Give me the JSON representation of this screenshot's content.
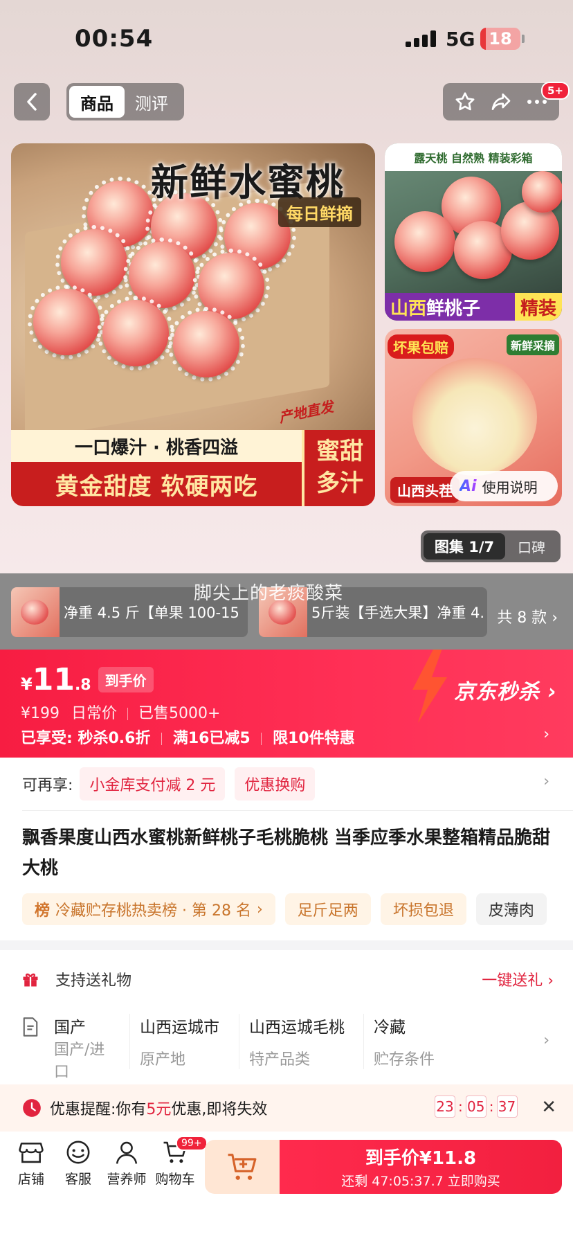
{
  "status_bar": {
    "time": "00:54",
    "network": "5G",
    "battery": "18"
  },
  "nav": {
    "tabs": [
      {
        "label": "商品",
        "active": true
      },
      {
        "label": "测评",
        "active": false
      }
    ],
    "message_badge": "5+",
    "icons": [
      "back-icon",
      "star-icon",
      "share-icon",
      "more-icon"
    ]
  },
  "gallery": {
    "main": {
      "title": "新鲜水蜜桃",
      "daily_tag": "每日鲜摘",
      "origin_tag": "产地直发",
      "banner_top": "一口爆汁 · 桃香四溢",
      "banner_bottom": "黄金甜度 软硬两吃",
      "banner_right": [
        "蜜甜",
        "多汁"
      ]
    },
    "right_top": {
      "top_text": "露天桃 自然熟 精装彩箱",
      "bottom_accent": "山西",
      "bottom_text": "鲜桃子",
      "pack_text": "精装"
    },
    "right_bottom": {
      "tag_left": "坏果包赔",
      "tag_right": "新鲜采摘",
      "bottom_text": "山西头茬"
    },
    "ai_button": {
      "mark": "Ai",
      "label": "使用说明"
    },
    "switch": {
      "active": "图集 1/7",
      "inactive": "口碑"
    }
  },
  "variants": {
    "watermark": "脚尖上的老痰酸菜",
    "items": [
      "净重 4.5 斤【单果 100-15",
      "5斤装【手选大果】净重 4."
    ],
    "count": "共 8 款"
  },
  "price": {
    "yen": "¥",
    "integer": "11",
    "decimal": ".8",
    "tag": "到手价",
    "original": "¥199",
    "original_label": "日常价",
    "sold": "已售5000+",
    "benefits_label": "已享受:",
    "benefits": [
      "秒杀0.6折",
      "满16已减5",
      "限10件特惠"
    ],
    "seckill": "京东秒杀"
  },
  "extra": {
    "label": "可再享:",
    "chips": [
      "小金库支付减 2 元",
      "优惠换购"
    ]
  },
  "product": {
    "title": "飘香果度山西水蜜桃新鲜桃子毛桃脆桃 当季应季水果整箱精品脆甜大桃",
    "rank_label": "榜",
    "rank_text": "冷藏贮存桃热卖榜 · 第 28 名",
    "tags": [
      "足斤足两",
      "坏损包退",
      "皮薄肉"
    ]
  },
  "gift": {
    "label": "支持送礼物",
    "action": "一键送礼"
  },
  "specs": [
    {
      "value": "国产",
      "label": "国产/进口"
    },
    {
      "value": "山西运城市",
      "label": "原产地"
    },
    {
      "value": "山西运城毛桃",
      "label": "特产品类"
    },
    {
      "value": "冷藏",
      "label": "贮存条件"
    }
  ],
  "reminder": {
    "prefix": "优惠提醒:你有",
    "amount": "5元",
    "suffix": "优惠,即将失效",
    "countdown": [
      "23",
      "05",
      "37"
    ]
  },
  "bottom_bar": {
    "tabs": [
      "店铺",
      "客服",
      "营养师",
      "购物车"
    ],
    "cart_badge": "99+",
    "buy_main": "到手价¥11.8",
    "buy_sub": "还剩 47:05:37.7 立即购买"
  },
  "colors": {
    "accent_red": "#f71d42",
    "seckill_bg": "#ff2f55",
    "tag_orange": "#c8742b"
  }
}
